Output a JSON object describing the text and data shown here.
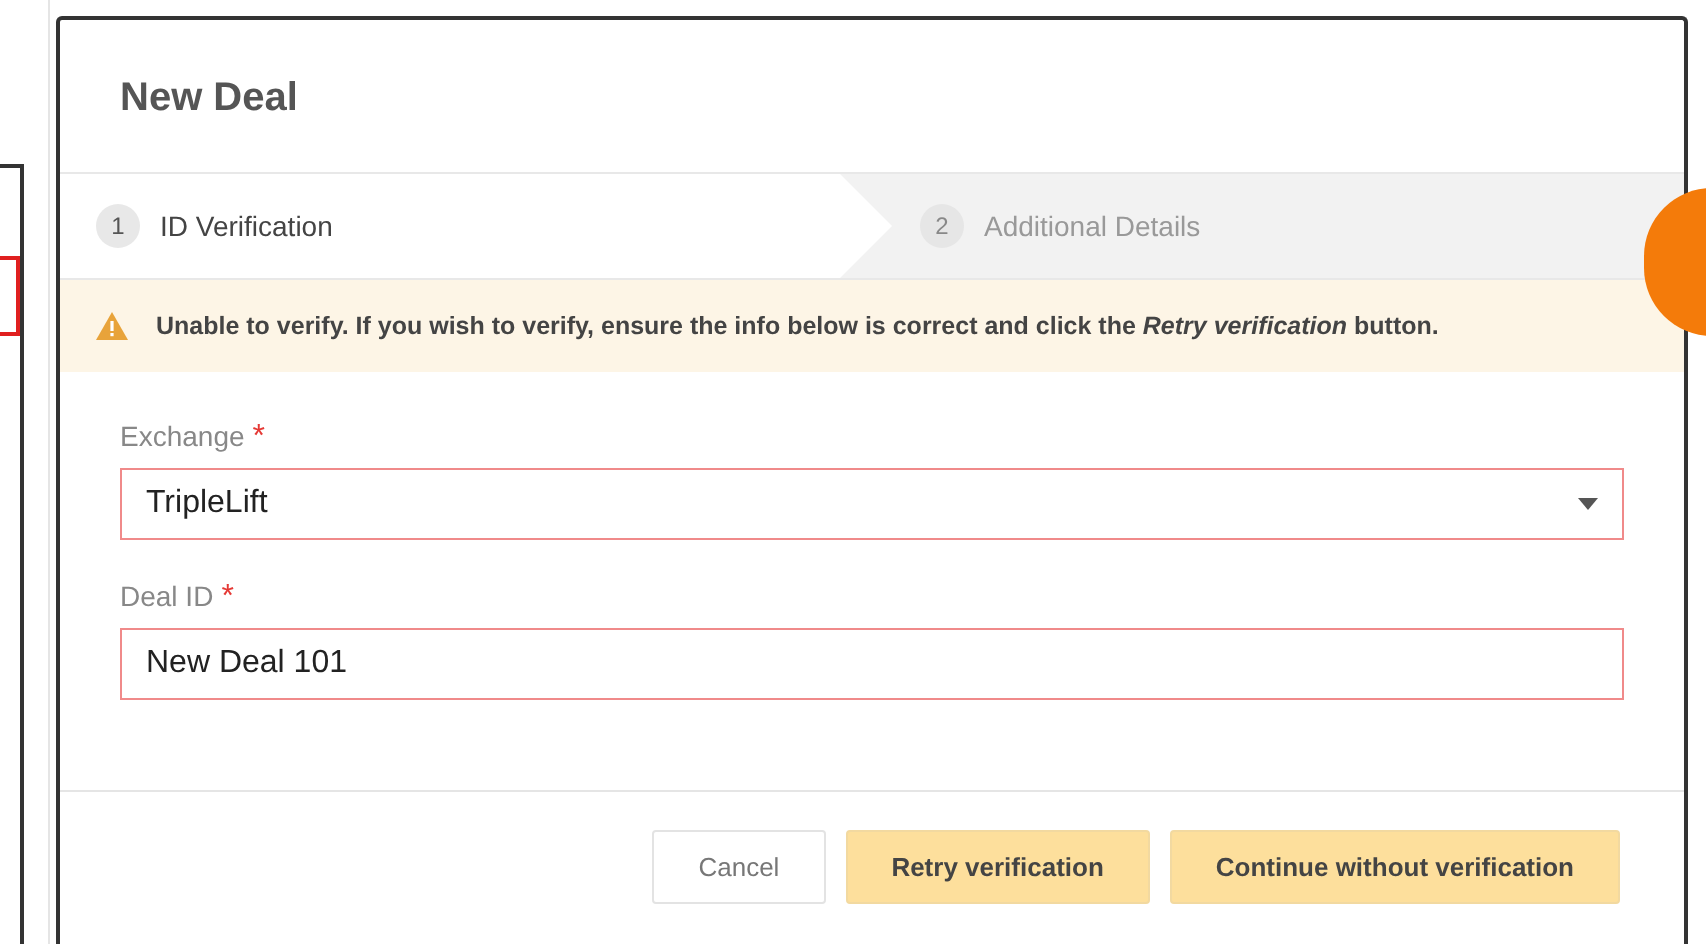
{
  "dialog": {
    "title": "New Deal"
  },
  "steps": [
    {
      "number": "1",
      "label": "ID Verification",
      "selected": true
    },
    {
      "number": "2",
      "label": "Additional Details",
      "selected": false
    }
  ],
  "alert": {
    "kind": "warning",
    "text": "Unable to verify. If you wish to verify, ensure the info below is correct and click the *Retry verification* button."
  },
  "fields": [
    {
      "kind": "select",
      "label": "Exchange",
      "required_mark": "*",
      "value": "TripleLift",
      "invalid": true
    },
    {
      "kind": "text",
      "label": "Deal ID",
      "required_mark": "*",
      "value": "New Deal 101",
      "invalid": true
    }
  ],
  "buttons": [
    {
      "label": "Cancel",
      "kind": "secondary"
    },
    {
      "label": "Retry verification",
      "kind": "primary"
    },
    {
      "label": "Continue without verification",
      "kind": "primary"
    }
  ]
}
